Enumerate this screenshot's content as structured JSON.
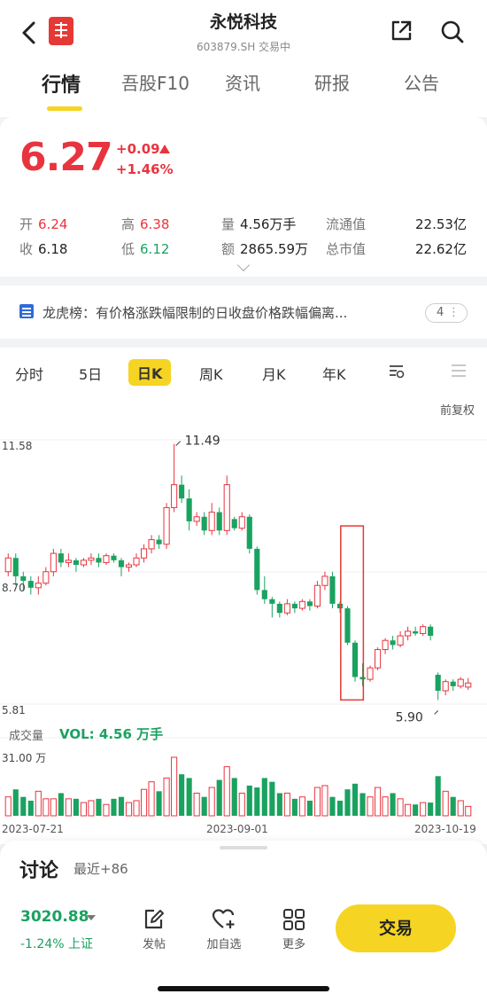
{
  "header": {
    "title": "永悦科技",
    "subtitle": "603879.SH  交易中",
    "tabs": [
      "行情",
      "吾股F10",
      "资讯",
      "研报",
      "公告"
    ],
    "active_tab": "行情"
  },
  "quote": {
    "price": "6.27",
    "change": "+0.09",
    "change_pct": "+1.46%",
    "open_label": "开",
    "open": "6.24",
    "close_label": "收",
    "close": "6.18",
    "high_label": "高",
    "high": "6.38",
    "low_label": "低",
    "low": "6.12",
    "volume_label": "量",
    "volume": "4.56万手",
    "amount_label": "额",
    "amount": "2865.59万",
    "float_cap_label": "流通值",
    "float_cap": "22.53亿",
    "total_cap_label": "总市值",
    "total_cap": "22.62亿"
  },
  "notice": {
    "text": "龙虎榜：有价格涨跌幅限制的日收盘价格跌幅偏离...",
    "badge": "4"
  },
  "period_tabs": [
    "分时",
    "5日",
    "日K",
    "周K",
    "月K",
    "年K"
  ],
  "active_period": "日K",
  "adjust_label": "前复权",
  "colors": {
    "up": "#e8343e",
    "down": "#1aa260",
    "accent": "#f5d423"
  },
  "chart_data": {
    "type": "candlestick",
    "price_axis": {
      "top": "11.58",
      "mid": "8.70",
      "bottom": "5.81"
    },
    "max_marker": "11.49",
    "min_marker": "5.90",
    "volume_title": "成交量",
    "volume_text": "VOL: 4.56 万手",
    "volume_axis_top": "31.00 万",
    "dates": [
      "2023-07-21",
      "2023-09-01",
      "2023-10-19"
    ],
    "candles": [
      [
        8.7,
        9.0,
        8.6,
        9.1
      ],
      [
        9.0,
        8.6,
        8.4,
        9.1
      ],
      [
        8.6,
        8.5,
        8.3,
        8.7
      ],
      [
        8.5,
        8.35,
        8.2,
        8.6
      ],
      [
        8.35,
        8.45,
        8.2,
        8.6
      ],
      [
        8.45,
        8.7,
        8.4,
        8.8
      ],
      [
        8.7,
        9.1,
        8.6,
        9.2
      ],
      [
        9.1,
        8.9,
        8.8,
        9.2
      ],
      [
        8.9,
        8.95,
        8.8,
        9.1
      ],
      [
        8.95,
        8.85,
        8.7,
        9.0
      ],
      [
        8.85,
        8.95,
        8.8,
        9.0
      ],
      [
        8.95,
        9.0,
        8.85,
        9.1
      ],
      [
        9.0,
        8.9,
        8.8,
        9.1
      ],
      [
        8.9,
        9.05,
        8.85,
        9.1
      ],
      [
        9.05,
        8.95,
        8.9,
        9.1
      ],
      [
        8.95,
        8.8,
        8.6,
        9.0
      ],
      [
        8.8,
        8.85,
        8.7,
        8.9
      ],
      [
        8.85,
        9.0,
        8.8,
        9.1
      ],
      [
        9.0,
        9.2,
        8.9,
        9.3
      ],
      [
        9.2,
        9.4,
        9.1,
        9.5
      ],
      [
        9.4,
        9.3,
        9.2,
        9.5
      ],
      [
        9.3,
        10.1,
        9.2,
        10.2
      ],
      [
        10.1,
        10.6,
        10.0,
        11.49
      ],
      [
        10.6,
        10.3,
        10.2,
        10.8
      ],
      [
        10.3,
        9.8,
        9.6,
        10.5
      ],
      [
        9.8,
        9.9,
        9.7,
        10.0
      ],
      [
        9.9,
        9.6,
        9.5,
        10.0
      ],
      [
        9.6,
        10.0,
        9.5,
        10.2
      ],
      [
        10.0,
        9.6,
        9.5,
        10.1
      ],
      [
        9.6,
        10.6,
        9.5,
        10.8
      ],
      [
        9.85,
        9.65,
        9.6,
        9.9
      ],
      [
        9.65,
        9.9,
        9.6,
        10.0
      ],
      [
        9.9,
        9.2,
        9.1,
        9.95
      ],
      [
        9.2,
        8.3,
        8.2,
        9.25
      ],
      [
        8.3,
        8.1,
        8.0,
        8.6
      ],
      [
        8.1,
        8.0,
        7.7,
        8.15
      ],
      [
        8.0,
        7.8,
        7.7,
        8.05
      ],
      [
        7.8,
        8.0,
        7.75,
        8.1
      ],
      [
        8.0,
        7.9,
        7.8,
        8.05
      ],
      [
        7.9,
        8.05,
        7.85,
        8.1
      ],
      [
        8.05,
        7.95,
        7.85,
        8.1
      ],
      [
        7.95,
        8.4,
        7.9,
        8.5
      ],
      [
        8.4,
        8.6,
        8.3,
        8.7
      ],
      [
        8.6,
        8.0,
        7.9,
        8.7
      ],
      [
        8.0,
        7.9,
        7.8,
        8.05
      ],
      [
        7.9,
        7.15,
        7.1,
        7.95
      ],
      [
        7.15,
        6.4,
        6.3,
        7.2
      ],
      [
        6.4,
        6.35,
        6.2,
        6.7
      ],
      [
        6.35,
        6.6,
        6.3,
        6.65
      ],
      [
        6.6,
        7.0,
        6.55,
        7.05
      ],
      [
        7.0,
        7.2,
        6.9,
        7.25
      ],
      [
        7.2,
        7.1,
        7.0,
        7.3
      ],
      [
        7.1,
        7.3,
        7.05,
        7.4
      ],
      [
        7.3,
        7.4,
        7.2,
        7.5
      ],
      [
        7.4,
        7.35,
        7.3,
        7.5
      ],
      [
        7.35,
        7.5,
        7.3,
        7.55
      ],
      [
        7.5,
        7.3,
        7.2,
        7.55
      ],
      [
        6.45,
        6.1,
        5.9,
        6.5
      ],
      [
        6.1,
        6.3,
        6.0,
        6.35
      ],
      [
        6.3,
        6.2,
        6.1,
        6.35
      ],
      [
        6.2,
        6.35,
        6.15,
        6.4
      ],
      [
        6.18,
        6.27,
        6.12,
        6.38
      ]
    ],
    "volumes": [
      10,
      14,
      10,
      8,
      13,
      9,
      9,
      12,
      9,
      9,
      7,
      8,
      9,
      6,
      9,
      10,
      7,
      8,
      14,
      18,
      13,
      20,
      31,
      22,
      20,
      12,
      10,
      15,
      19,
      26,
      20,
      12,
      16,
      15,
      20,
      18,
      12,
      12,
      9,
      10,
      8,
      15,
      16,
      10,
      8,
      14,
      17,
      12,
      10,
      15,
      10,
      12,
      9,
      6,
      6,
      7,
      7,
      21,
      13,
      10,
      8,
      5
    ]
  },
  "bottom": {
    "discussion_title": "讨论",
    "discussion_sub": "最近+86",
    "index_value": "3020.88",
    "index_change": "-1.24% 上证",
    "actions": [
      "发帖",
      "加自选",
      "更多"
    ],
    "trade_label": "交易"
  }
}
